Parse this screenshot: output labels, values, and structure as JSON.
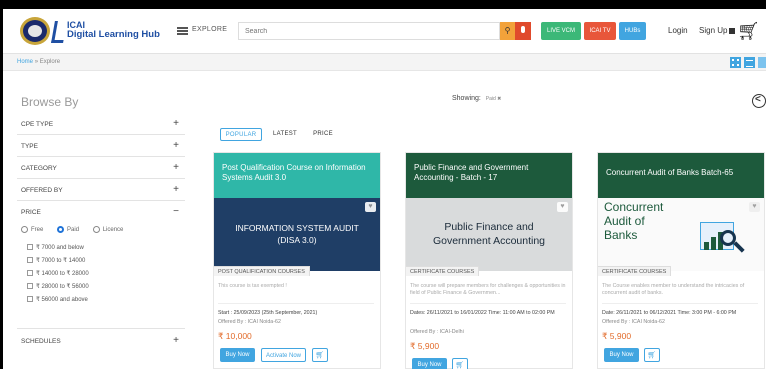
{
  "header": {
    "brand_top": "ICAI",
    "brand_bottom": "Digital Learning Hub",
    "explore_label": "EXPLORE",
    "search_placeholder": "Search",
    "live_vcm_label": "LIVE VCM",
    "icai_tv_label": "ICAI TV",
    "hubs_label": "HUBs",
    "login_label": "Login",
    "signup_label": "Sign Up"
  },
  "breadcrumb": {
    "home": "Home",
    "separator": "»",
    "current": "Explore"
  },
  "sidebar": {
    "title": "Browse By",
    "filters": [
      {
        "label": "CPE TYPE",
        "sign": "+"
      },
      {
        "label": "TYPE",
        "sign": "+"
      },
      {
        "label": "CATEGORY",
        "sign": "+"
      },
      {
        "label": "OFFERED BY",
        "sign": "+"
      },
      {
        "label": "PRICE",
        "sign": "−"
      },
      {
        "label": "SCHEDULES",
        "sign": "+"
      }
    ],
    "price_options": [
      "Free",
      "Paid",
      "Licence"
    ],
    "price_selected": "Paid",
    "price_ranges": [
      "₹ 7000 and below",
      "₹ 7000 to ₹ 14000",
      "₹ 14000 to ₹ 28000",
      "₹ 28000 to ₹ 56000",
      "₹ 56000 and above"
    ]
  },
  "main": {
    "showing_label": "Showing:",
    "active_tag": "Paid ✖",
    "sort_tabs": [
      "POPULAR",
      "LATEST",
      "PRICE"
    ]
  },
  "cards": [
    {
      "title": "Post Qualification Course on Information Systems Audit 3.0",
      "image_text": "INFORMATION SYSTEM AUDIT\n(DISA 3.0)",
      "category": "POST QUALIFICATION COURSES",
      "description": "This course is tax exempted !",
      "dates": "Start : 25/09/2023 (25th September, 2021)",
      "offered_by": "Offered By : ICAI Noida-62",
      "price": "₹ 10,000",
      "buy_label": "Buy Now",
      "activate_label": "Activate Now"
    },
    {
      "title": "Public Finance and Government Accounting - Batch - 17",
      "image_text": "Public Finance and\nGovernment Accounting",
      "category": "CERTIFICATE COURSES",
      "description": "The course will prepare members for challenges & opportunities in field of Public Finance & Governmen...",
      "dates": "Dates: 26/11/2021 to 16/01/2022 Time: 11:00 AM to 02:00 PM",
      "offered_by": "Offered By : ICAI-Delhi",
      "price": "₹ 5,900",
      "buy_label": "Buy Now"
    },
    {
      "title": "Concurrent Audit of Banks Batch-65",
      "image_text": "Concurrent\nAudit of\nBanks",
      "category": "CERTIFICATE COURSES",
      "description": "The Course enables member to understand the intricacies of concurrent audit of banks.",
      "dates": "Date: 26/11/2021 to 06/12/2021 Time: 3:00 PM - 6:00 PM",
      "offered_by": "Offered By : ICAI Noida-62",
      "price": "₹ 5,900",
      "buy_label": "Buy Now"
    }
  ],
  "icons": {
    "search": "search-icon",
    "mic": "microphone-icon",
    "cart": "cart-icon",
    "share": "share-icon",
    "wishlist": "heart-icon"
  },
  "colors": {
    "accent": "#41a5e0",
    "price": "#e26b2a",
    "live_vcm": "#3cb878",
    "icai_tv": "#e8563a",
    "teal_card": "#2fb7a8",
    "green_card": "#1d5a3c"
  }
}
